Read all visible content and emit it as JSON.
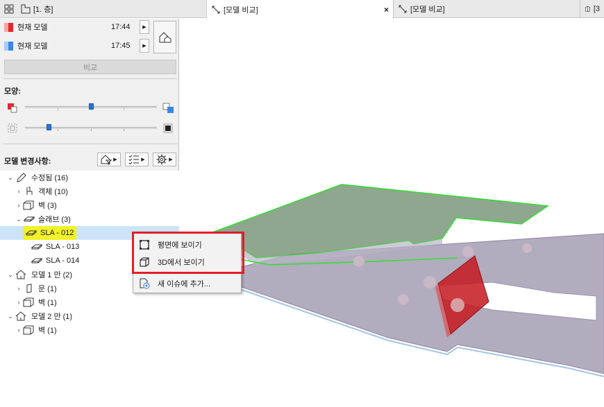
{
  "tabs": [
    {
      "label": "[1. 층]"
    },
    {
      "label": "[모델 비교]",
      "close": "×"
    },
    {
      "label": "[모델 비교]"
    },
    {
      "label": "[3"
    }
  ],
  "models": [
    {
      "name": "현재 모델",
      "time": "17:44",
      "color": "#e5262b"
    },
    {
      "name": "현재 모델",
      "time": "17:45",
      "color": "#3a86e8"
    }
  ],
  "compare_label": "비교",
  "appearance_title": "모양:",
  "sliders": [
    {
      "value": 0.5
    },
    {
      "value": 0.18
    }
  ],
  "changes_title": "모델 변경사항:",
  "tree": {
    "modified": {
      "label": "수정됨 (16)"
    },
    "objects": {
      "label": "객체 (10)"
    },
    "walls": {
      "label": "벽 (3)"
    },
    "slabs": {
      "label": "슬래브 (3)"
    },
    "sla012": {
      "label": "SLA - 012"
    },
    "sla013": {
      "label": "SLA - 013"
    },
    "sla014": {
      "label": "SLA - 014"
    },
    "model1_only": {
      "label": "모델 1 만 (2)"
    },
    "doors": {
      "label": "문 (1)"
    },
    "walls1": {
      "label": "벽 (1)"
    },
    "model2_only": {
      "label": "모델 2 만 (1)"
    },
    "walls2": {
      "label": "벽 (1)"
    }
  },
  "context_menu": {
    "show_in_plan": "평면에 보이기",
    "show_in_3d": "3D에서 보이기",
    "add_issue": "새 이슈에 추가..."
  },
  "colors": {
    "highlight_red": "#e01f26",
    "selection": "#cce4f7",
    "accent_yellow": "#f0f22a"
  }
}
